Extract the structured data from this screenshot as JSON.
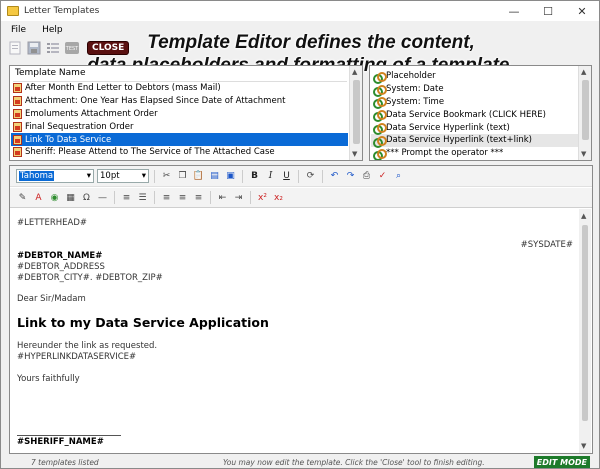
{
  "window": {
    "title": "Letter Templates",
    "controls": {
      "minimize": "—",
      "maximize": "☐",
      "close": "✕"
    }
  },
  "menu": {
    "items": [
      "File",
      "Help"
    ]
  },
  "toolbar": {
    "icons": [
      "new-icon",
      "save-icon",
      "list-icon",
      "test-icon"
    ],
    "test_label": "TEST",
    "close_label": "CLOSE"
  },
  "callout": {
    "line1": "Template Editor defines the content,",
    "line2": "data placeholders and formatting of a template."
  },
  "templates": {
    "header": "Template Name",
    "items": [
      {
        "name": "After Month End Letter to Debtors (mass Mail)",
        "selected": false
      },
      {
        "name": "Attachment: One Year Has Elapsed Since Date of Attachment",
        "selected": false
      },
      {
        "name": "Emoluments Attachment Order",
        "selected": false
      },
      {
        "name": "Final Sequestration Order",
        "selected": false
      },
      {
        "name": "Link To Data Service",
        "selected": true
      },
      {
        "name": "Sheriff: Please Attend to The Service of The Attached Case",
        "selected": false
      }
    ]
  },
  "fields": {
    "items": [
      {
        "label": "Placeholder",
        "highlight": false
      },
      {
        "label": "System: Date",
        "highlight": false
      },
      {
        "label": "System: Time",
        "highlight": false
      },
      {
        "label": "Data Service Bookmark (CLICK HERE)",
        "highlight": false
      },
      {
        "label": "Data Service Hyperlink (text)",
        "highlight": false
      },
      {
        "label": "Data Service Hyperlink (text+link)",
        "highlight": true
      },
      {
        "label": "*** Prompt the operator ***",
        "highlight": false
      }
    ]
  },
  "format_toolbar": {
    "font": "Tahoma",
    "size": "10pt",
    "bold_label": "B",
    "italic_label": "I",
    "underline_label": "U"
  },
  "document": {
    "letterhead": "#LETTERHEAD#",
    "sysdate": "#SYSDATE#",
    "debtor_name": "#DEBTOR_NAME#",
    "debtor_address": "#DEBTOR_ADDRESS",
    "debtor_city_zip": "#DEBTOR_CITY#. #DEBTOR_ZIP#",
    "salutation": "Dear Sir/Madam",
    "heading": "Link to my Data Service Application",
    "body1": "Hereunder the link as requested.",
    "body2": "#HYPERLINKDATASERVICE#",
    "closing": "Yours faithfully",
    "sheriff_name": "#SHERIFF_NAME#"
  },
  "status": {
    "count": "7 templates listed",
    "message": "You may now edit the template. Click the 'Close' tool to finish editing.",
    "mode": "EDIT MODE"
  }
}
